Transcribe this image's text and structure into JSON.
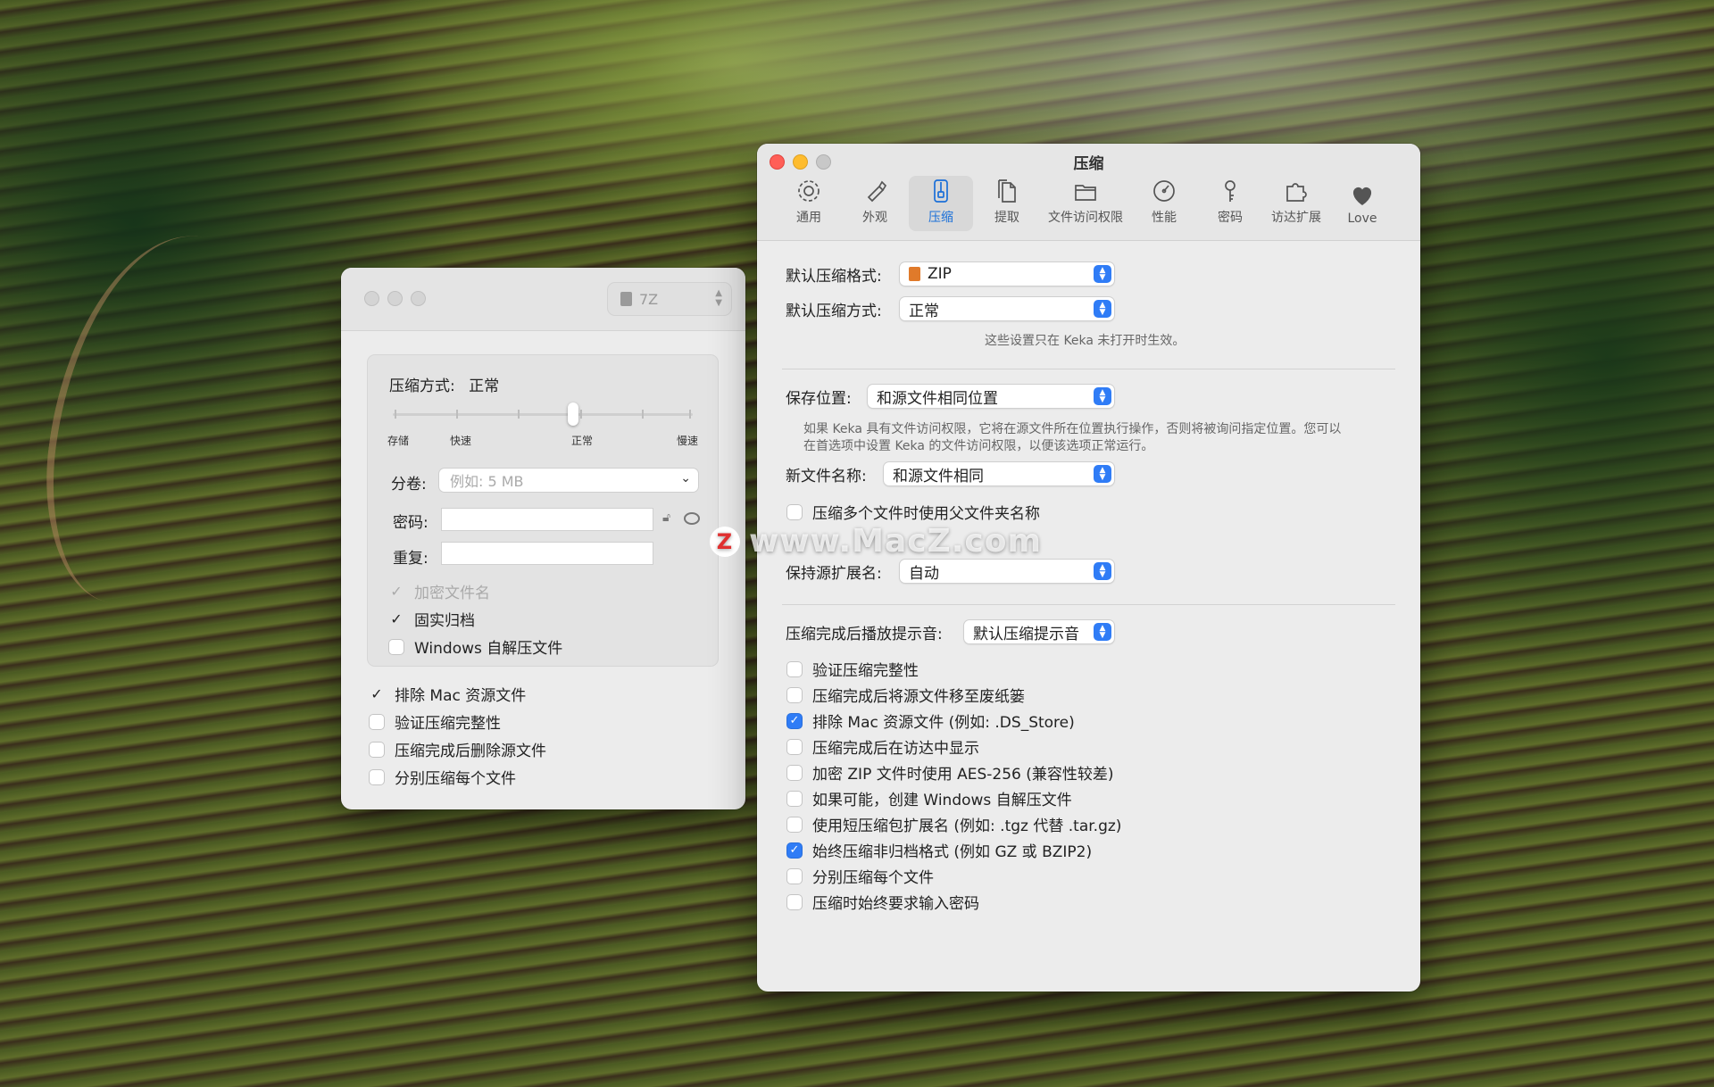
{
  "prefs": {
    "title": "压缩",
    "toolbar": [
      {
        "label": "通用",
        "icon": "gear-icon"
      },
      {
        "label": "外观",
        "icon": "brush-icon"
      },
      {
        "label": "压缩",
        "icon": "zipper-icon"
      },
      {
        "label": "提取",
        "icon": "documents-icon"
      },
      {
        "label": "文件访问权限",
        "icon": "folder-icon"
      },
      {
        "label": "性能",
        "icon": "gauge-icon"
      },
      {
        "label": "密码",
        "icon": "key-icon"
      },
      {
        "label": "访达扩展",
        "icon": "puzzle-icon"
      },
      {
        "label": "Love",
        "icon": "heart-icon"
      }
    ],
    "default_format_label": "默认压缩格式:",
    "default_format_value": "ZIP",
    "default_method_label": "默认压缩方式:",
    "default_method_value": "正常",
    "note1": "这些设置只在 Keka 未打开时生效。",
    "save_location_label": "保存位置:",
    "save_location_value": "和源文件相同位置",
    "note2_line1": "如果 Keka 具有文件访问权限，它将在源文件所在位置执行操作，否则将被询问指定位置。您可以",
    "note2_line2": "在首选项中设置 Keka 的文件访问权限，以便该选项正常运行。",
    "new_name_label": "新文件名称:",
    "new_name_value": "和源文件相同",
    "use_parent_folder": "压缩多个文件时使用父文件夹名称",
    "keep_ext_label": "保持源扩展名:",
    "keep_ext_value": "自动",
    "sound_label": "压缩完成后播放提示音:",
    "sound_value": "默认压缩提示音",
    "options": [
      {
        "label": "验证压缩完整性",
        "checked": false
      },
      {
        "label": "压缩完成后将源文件移至废纸篓",
        "checked": false
      },
      {
        "label": "排除 Mac 资源文件 (例如: .DS_Store)",
        "checked": true
      },
      {
        "label": "压缩完成后在访达中显示",
        "checked": false
      },
      {
        "label": "加密 ZIP 文件时使用 AES-256 (兼容性较差)",
        "checked": false
      },
      {
        "label": "如果可能，创建 Windows 自解压文件",
        "checked": false
      },
      {
        "label": "使用短压缩包扩展名 (例如: .tgz 代替 .tar.gz)",
        "checked": false
      },
      {
        "label": "始终压缩非归档格式 (例如 GZ 或 BZIP2)",
        "checked": true
      },
      {
        "label": "分别压缩每个文件",
        "checked": false
      },
      {
        "label": "压缩时始终要求输入密码",
        "checked": false
      }
    ]
  },
  "small": {
    "format": "7Z",
    "method_label": "压缩方式:",
    "method_value": "正常",
    "speed_labels": [
      "存储",
      "快速",
      "正常",
      "慢速"
    ],
    "speed_level": 0.6,
    "split_label": "分卷:",
    "split_placeholder": "例如: 5 MB",
    "password_label": "密码:",
    "repeat_label": "重复:",
    "encrypt_names": "加密文件名",
    "solid_archive": "固实归档",
    "windows_sfx": "Windows 自解压文件",
    "bottom_options": [
      {
        "label": "排除 Mac 资源文件",
        "checked": true
      },
      {
        "label": "验证压缩完整性",
        "checked": false
      },
      {
        "label": "压缩完成后删除源文件",
        "checked": false
      },
      {
        "label": "分别压缩每个文件",
        "checked": false
      }
    ]
  },
  "watermark": {
    "badge": "Z",
    "text": "www.MacZ.com"
  }
}
